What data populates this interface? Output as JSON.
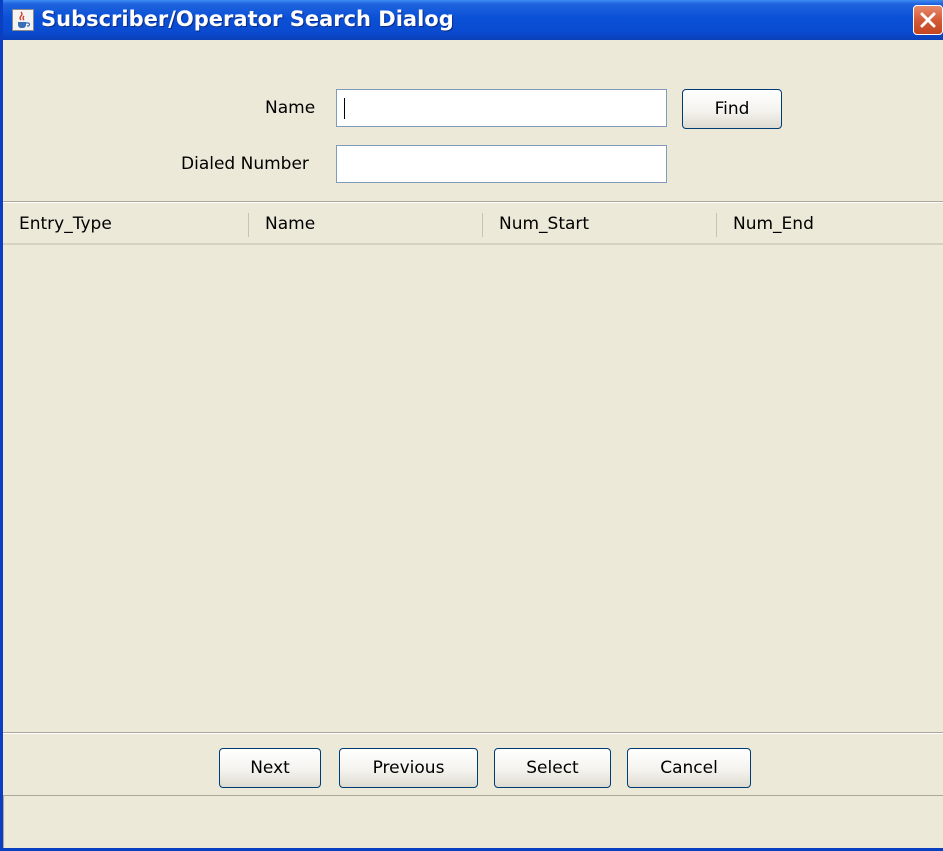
{
  "window": {
    "title": "Subscriber/Operator Search Dialog",
    "app_icon": "java-cup-icon",
    "close_icon": "close-x-icon",
    "colors": {
      "title_bar": "#0a50d6",
      "body": "#ece9d8",
      "close_button": "#d55a37"
    }
  },
  "search": {
    "name_label": "Name",
    "name_value": "",
    "find_label": "Find",
    "dialed_label": "Dialed Number",
    "dialed_value": ""
  },
  "table": {
    "columns": [
      "Entry_Type",
      "Name",
      "Num_Start",
      "Num_End"
    ],
    "rows": []
  },
  "footer": {
    "next_label": "Next",
    "previous_label": "Previous",
    "select_label": "Select",
    "cancel_label": "Cancel"
  },
  "status": {
    "text": ""
  }
}
